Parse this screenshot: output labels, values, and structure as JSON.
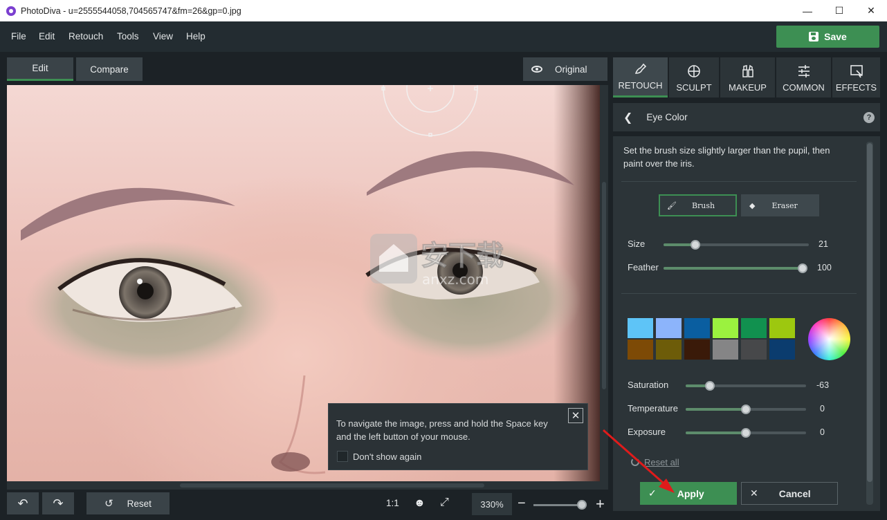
{
  "window": {
    "title": "PhotoDiva - u=2555544058,704565747&fm=26&gp=0.jpg",
    "controls": {
      "minimize": "—",
      "maximize": "☐",
      "close": "✕"
    }
  },
  "menu": {
    "items": [
      "File",
      "Edit",
      "Retouch",
      "Tools",
      "View",
      "Help"
    ],
    "save_label": "Save"
  },
  "view_tabs": {
    "edit": "Edit",
    "compare": "Compare",
    "original": "Original"
  },
  "canvas": {
    "watermark_text": "安下载",
    "watermark_sub": "anxz.com"
  },
  "tooltip": {
    "message": "To navigate the image, press and hold the Space key and the left button of your mouse.",
    "checkbox_label": "Don't show again",
    "checked": false
  },
  "bottom": {
    "reset_label": "Reset",
    "ratio_label": "1:1",
    "zoom_value": "330%",
    "zoom_minus": "−",
    "zoom_plus": "+",
    "zoom_level": 0.88
  },
  "right_tabs": [
    {
      "label": "RETOUCH",
      "icon": "retouch-brush-icon",
      "active": true
    },
    {
      "label": "SCULPT",
      "icon": "sculpt-icon",
      "active": false
    },
    {
      "label": "MAKEUP",
      "icon": "makeup-icon",
      "active": false
    },
    {
      "label": "COMMON",
      "icon": "sliders-icon",
      "active": false
    },
    {
      "label": "EFFECTS",
      "icon": "effects-icon",
      "active": false
    }
  ],
  "panel": {
    "title": "Eye Color",
    "help": "?",
    "instruction": "Set the brush size slightly larger than the pupil, then paint over the iris.",
    "tools": {
      "brush": "Brush",
      "eraser": "Eraser",
      "active": "brush"
    },
    "size": {
      "label": "Size",
      "value": "21",
      "fraction": 0.22
    },
    "feather": {
      "label": "Feather",
      "value": "100",
      "fraction": 1.0
    },
    "swatches": [
      "#5ec4f7",
      "#8cb4fb",
      "#0a5ea0",
      "#9bf23f",
      "#11914f",
      "#9dc80f",
      "#7d4a06",
      "#6d5c09",
      "#3a1a09",
      "#858586",
      "#47484a",
      "#0b3c6e"
    ],
    "saturation": {
      "label": "Saturation",
      "value": "-63",
      "fraction": 0.2
    },
    "temperature": {
      "label": "Temperature",
      "value": "0",
      "fraction": 0.5
    },
    "exposure": {
      "label": "Exposure",
      "value": "0",
      "fraction": 0.5
    },
    "reset_all": "Reset all",
    "apply": "Apply",
    "cancel": "Cancel"
  },
  "colors": {
    "accent": "#3d8f53",
    "panel": "#2c3438",
    "annotation_arrow": "#e01b1b"
  }
}
